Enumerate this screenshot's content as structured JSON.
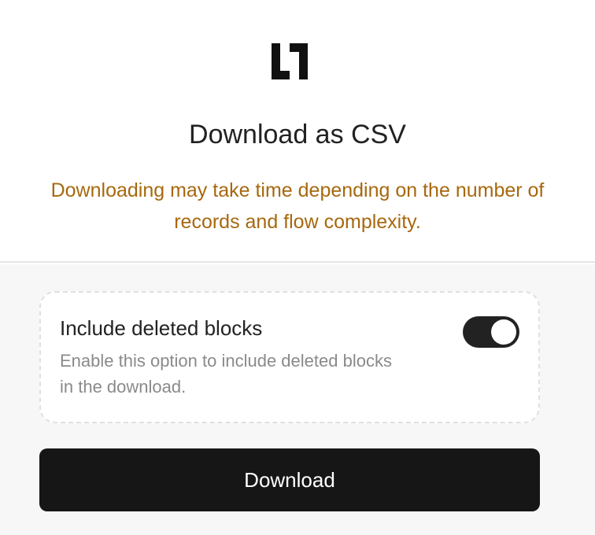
{
  "dialog": {
    "logo_icon": "brand-logo-icon",
    "title": "Download as CSV",
    "warning": "Downloading may take time depending on the number of records and flow complexity.",
    "warning_color": "#a7680e"
  },
  "option": {
    "title": "Include deleted blocks",
    "description": "Enable this option to include deleted blocks in the download.",
    "toggle_on": true
  },
  "actions": {
    "download_label": "Download",
    "button_color": "#161616"
  }
}
